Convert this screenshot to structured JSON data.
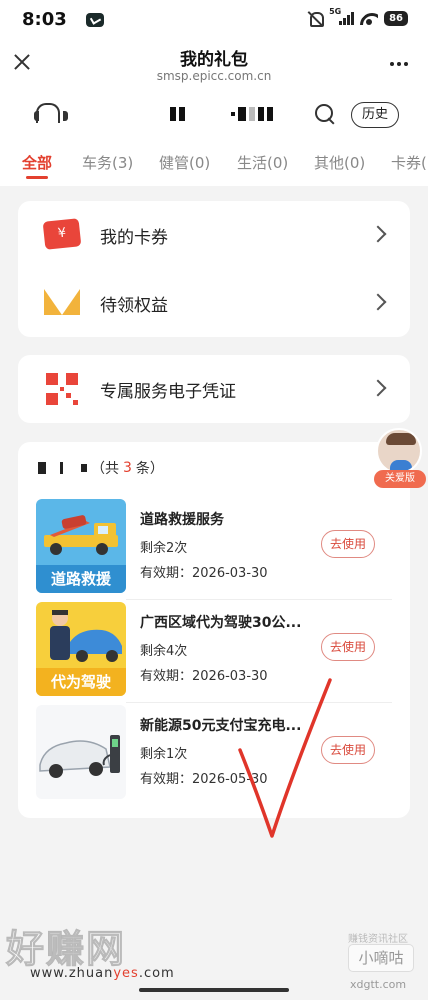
{
  "status_bar": {
    "time": "8:03",
    "network": "5G",
    "battery": "86"
  },
  "header": {
    "title": "我的礼包",
    "subtitle": "smsp.epicc.com.cn"
  },
  "toolbar": {
    "history_label": "历史"
  },
  "tabs": [
    {
      "label": "全部",
      "active": true
    },
    {
      "label": "车务(3)"
    },
    {
      "label": "健管(0)"
    },
    {
      "label": "生活(0)"
    },
    {
      "label": "其他(0)"
    },
    {
      "label": "卡券("
    }
  ],
  "menu": {
    "coupons": "我的卡券",
    "benefits": "待领权益",
    "voucher": "专属服务电子凭证"
  },
  "list": {
    "count_prefix": "（共",
    "count": "3",
    "count_suffix": "条）",
    "use_label": "去使用",
    "items": [
      {
        "thumb_caption": "道路救援",
        "name": "道路救援服务",
        "remaining": "剩余2次",
        "valid": "有效期：2026-03-30"
      },
      {
        "thumb_caption": "代为驾驶",
        "name": "广西区域代为驾驶30公...",
        "remaining": "剩余4次",
        "valid": "有效期：2026-03-30"
      },
      {
        "thumb_caption": "",
        "name": "新能源50元支付宝充电...",
        "remaining": "剩余1次",
        "valid": "有效期：2026-05-30"
      }
    ]
  },
  "care_badge": "关爱版",
  "watermarks": {
    "big": "好赚网",
    "url_prefix": "www.zhuan",
    "url_highlight": "yes",
    "url_suffix": ".com",
    "right_top": "赚钱资讯社区",
    "right_box": "小嘀咕",
    "right_url": "xdgtt.com"
  },
  "colors": {
    "accent": "#e3402f",
    "card": "#ffffff",
    "background": "#f3f3f3"
  }
}
